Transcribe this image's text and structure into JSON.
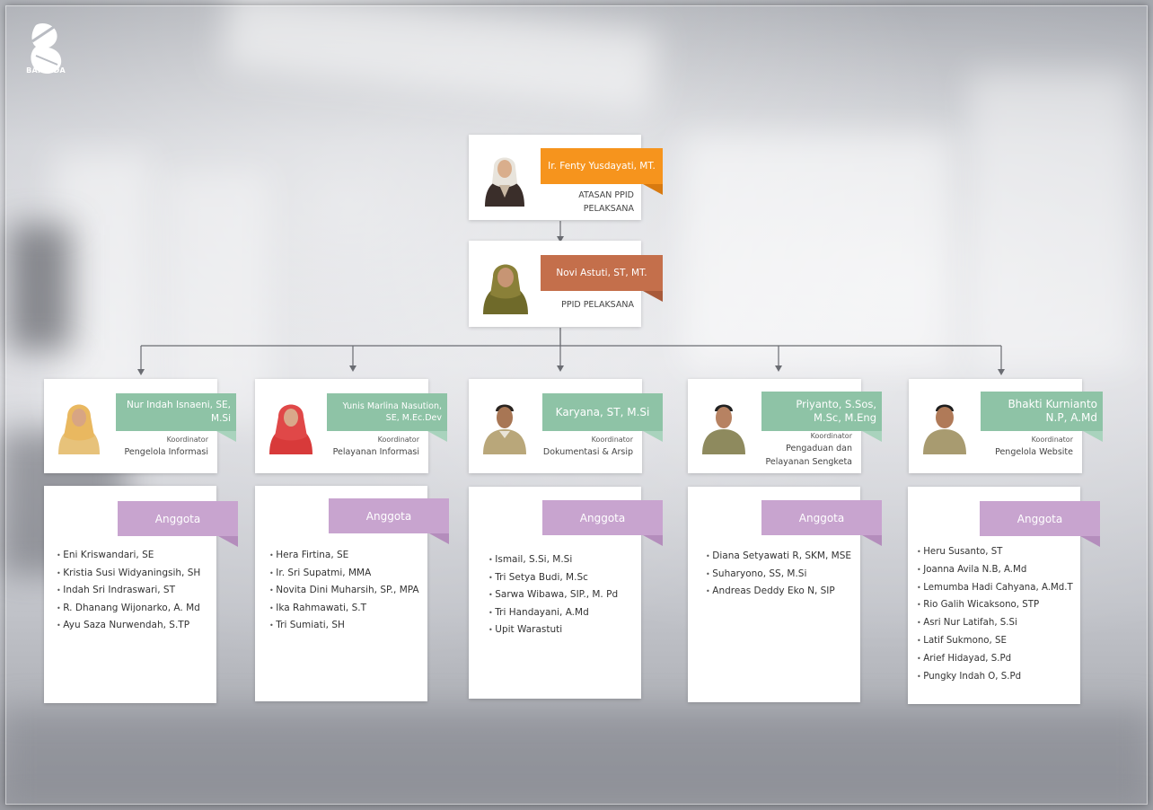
{
  "logo": {
    "text": "BAPPEDA"
  },
  "colors": {
    "orange": "#f6941d",
    "orange_fold": "#d87a10",
    "terracotta": "#c46f4b",
    "terracotta_fold": "#a85a3a",
    "green": "#8ec3a6",
    "green_fold": "#a9d3bd",
    "purple": "#c8a4cf"
  },
  "top": {
    "name": "Ir. Fenty Yusdayati, MT.",
    "role_line1": "ATASAN PPID",
    "role_line2": "PELAKSANA"
  },
  "second": {
    "name": "Novi Astuti, ST, MT.",
    "role": "PPID PELAKSANA"
  },
  "coordinators": [
    {
      "name": "Nur Indah Isnaeni, SE, M.Si",
      "title": "Koordinator",
      "unit": "Pengelola Informasi",
      "members_label": "Anggota",
      "members": [
        "Eni Kriswandari, SE",
        "Kristia Susi Widyaningsih, SH",
        "Indah Sri Indraswari, ST",
        "R. Dhanang Wijonarko, A. Md",
        "Ayu Saza Nurwendah, S.TP"
      ]
    },
    {
      "name": "Yunis Marlina Nasution, SE, M.Ec.Dev",
      "title": "Koordinator",
      "unit": "Pelayanan Informasi",
      "members_label": "Anggota",
      "members": [
        "Hera Firtina, SE",
        "Ir. Sri Supatmi, MMA",
        "Novita Dini Muharsih, SP., MPA",
        "Ika Rahmawati, S.T",
        "Tri Sumiati, SH"
      ]
    },
    {
      "name": "Karyana, ST, M.Si",
      "title": "Koordinator",
      "unit": "Dokumentasi & Arsip",
      "members_label": "Anggota",
      "members": [
        "Ismail, S.Si, M.Si",
        "Tri Setya Budi, M.Sc",
        "Sarwa Wibawa, SIP., M. Pd",
        "Tri Handayani, A.Md",
        "Upit Warastuti"
      ]
    },
    {
      "name": "Priyanto, S.Sos, M.Sc, M.Eng",
      "title": "Koordinator",
      "unit_line1": "Pengaduan dan",
      "unit_line2": "Pelayanan Sengketa",
      "members_label": "Anggota",
      "members": [
        "Diana Setyawati R, SKM, MSE",
        "Suharyono, SS, M.Si",
        "Andreas Deddy Eko N, SIP"
      ]
    },
    {
      "name": "Bhakti Kurnianto N.P, A.Md",
      "title": "Koordinator",
      "unit": "Pengelola Website",
      "members_label": "Anggota",
      "members": [
        "Heru Susanto, ST",
        "Joanna Avila N.B, A.Md",
        "Lemumba Hadi Cahyana, A.Md.T",
        "Rio Galih Wicaksono, STP",
        "Asri Nur Latifah, S.Si",
        "Latif Sukmono, SE",
        "Arief Hidayad, S.Pd",
        "Pungky Indah O, S.Pd"
      ]
    }
  ]
}
